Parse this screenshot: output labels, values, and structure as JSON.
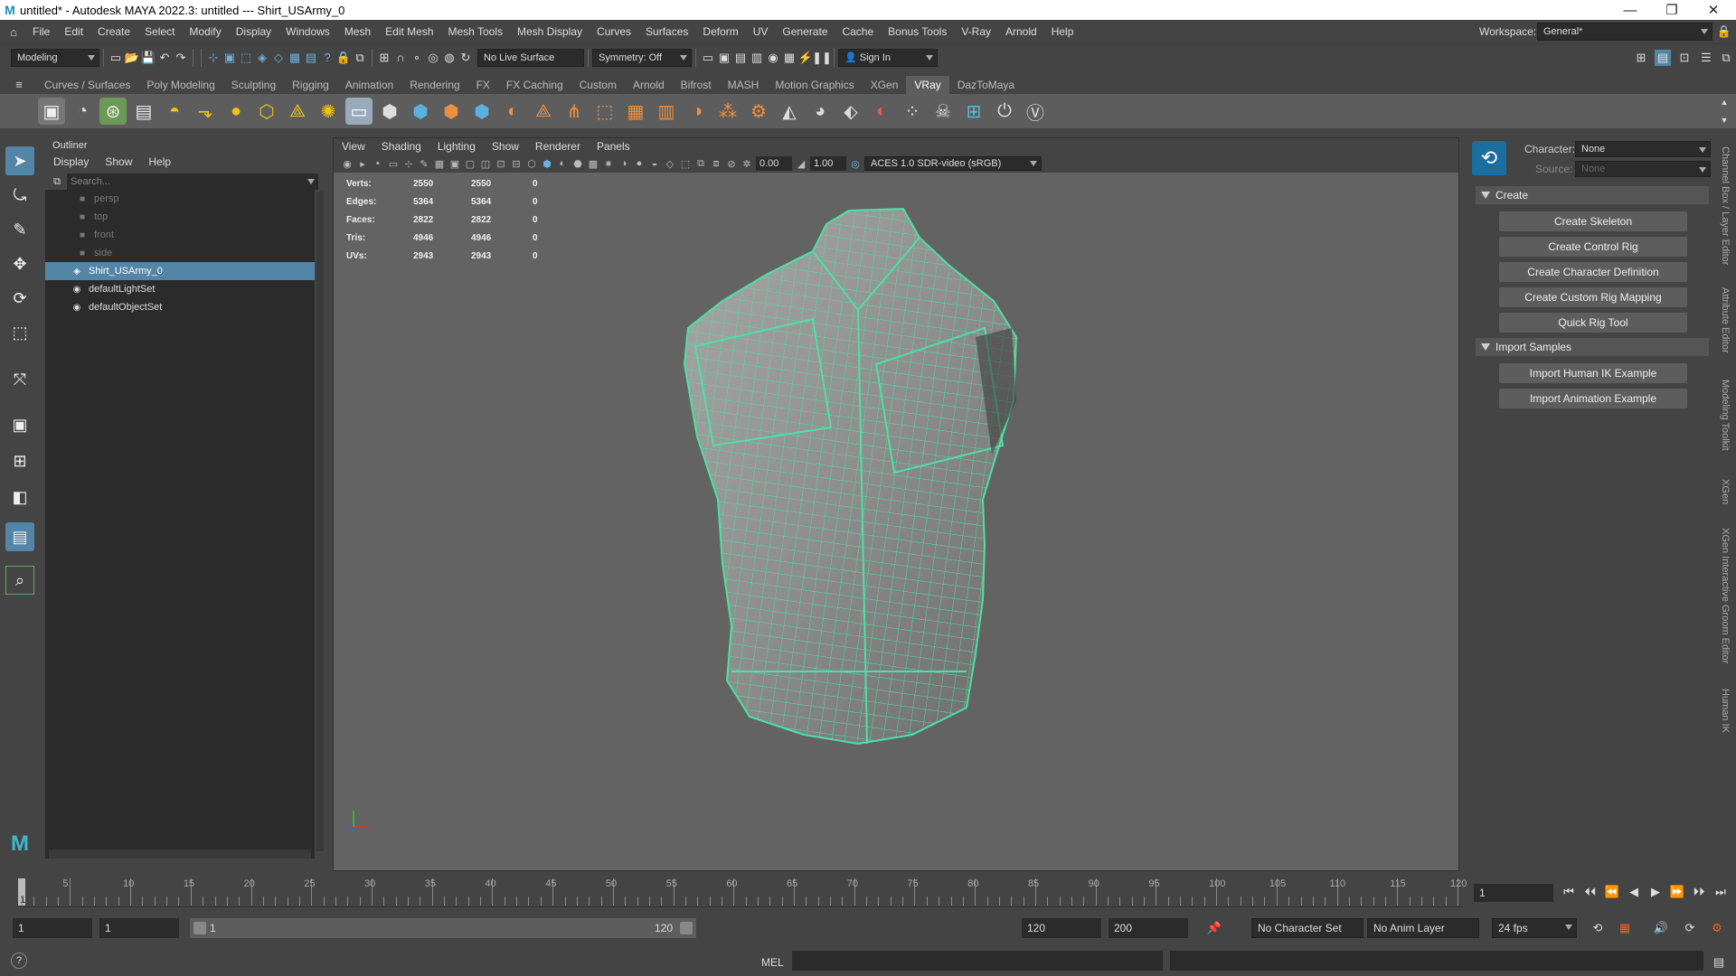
{
  "window": {
    "title": "untitled* - Autodesk MAYA 2022.3: untitled   ---   Shirt_USArmy_0",
    "logo": "M"
  },
  "menu": [
    "File",
    "Edit",
    "Create",
    "Select",
    "Modify",
    "Display",
    "Windows",
    "Mesh",
    "Edit Mesh",
    "Mesh Tools",
    "Mesh Display",
    "Curves",
    "Surfaces",
    "Deform",
    "UV",
    "Generate",
    "Cache",
    "Bonus Tools",
    "V-Ray",
    "Arnold",
    "Help"
  ],
  "workspace": {
    "label": "Workspace:",
    "value": "General*"
  },
  "status": {
    "mode": "Modeling",
    "live_surface": "No Live Surface",
    "symmetry": "Symmetry: Off",
    "sign_in": "Sign In"
  },
  "shelf_tabs": [
    "Curves / Surfaces",
    "Poly Modeling",
    "Sculpting",
    "Rigging",
    "Animation",
    "Rendering",
    "FX",
    "FX Caching",
    "Custom",
    "Arnold",
    "Bifrost",
    "MASH",
    "Motion Graphics",
    "XGen",
    "VRay",
    "DazToMaya"
  ],
  "active_shelf_tab": "VRay",
  "outliner": {
    "title": "Outliner",
    "menu": [
      "Display",
      "Show",
      "Help"
    ],
    "search_placeholder": "Search...",
    "items": [
      {
        "label": "persp",
        "icon": "camera-icon"
      },
      {
        "label": "top",
        "icon": "camera-icon"
      },
      {
        "label": "front",
        "icon": "camera-icon"
      },
      {
        "label": "side",
        "icon": "camera-icon"
      },
      {
        "label": "Shirt_USArmy_0",
        "icon": "mesh-icon"
      },
      {
        "label": "defaultLightSet",
        "icon": "set-icon"
      },
      {
        "label": "defaultObjectSet",
        "icon": "set-icon"
      }
    ],
    "selected": "Shirt_USArmy_0"
  },
  "viewport": {
    "menu": [
      "View",
      "Shading",
      "Lighting",
      "Show",
      "Renderer",
      "Panels"
    ],
    "exposure": "0.00",
    "gamma": "1.00",
    "color_space": "ACES 1.0 SDR-video (sRGB)",
    "hud": [
      {
        "label": "Verts:",
        "a": "2550",
        "b": "2550",
        "c": "0"
      },
      {
        "label": "Edges:",
        "a": "5364",
        "b": "5364",
        "c": "0"
      },
      {
        "label": "Faces:",
        "a": "2822",
        "b": "2822",
        "c": "0"
      },
      {
        "label": "Tris:",
        "a": "4946",
        "b": "4946",
        "c": "0"
      },
      {
        "label": "UVs:",
        "a": "2943",
        "b": "2943",
        "c": "0"
      }
    ]
  },
  "hik": {
    "character_label": "Character:",
    "character_value": "None",
    "source_label": "Source:",
    "source_value": "None",
    "create_section": "Create",
    "create_buttons": [
      "Create Skeleton",
      "Create Control Rig",
      "Create Character Definition",
      "Create Custom Rig Mapping",
      "Quick Rig Tool"
    ],
    "import_section": "Import Samples",
    "import_buttons": [
      "Import Human IK Example",
      "Import Animation Example"
    ]
  },
  "side_tabs": [
    "Channel Box / Layer Editor",
    "Attribute Editor",
    "Modeling Toolkit",
    "XGen",
    "XGen Interactive Groom Editor",
    "Human IK"
  ],
  "timeline": {
    "ticks": [
      "5",
      "10",
      "15",
      "20",
      "25",
      "30",
      "35",
      "40",
      "45",
      "50",
      "55",
      "60",
      "65",
      "70",
      "75",
      "80",
      "85",
      "90",
      "95",
      "100",
      "105",
      "110",
      "115",
      "120"
    ],
    "current": "1",
    "current_field": "1"
  },
  "range": {
    "start": "1",
    "playback_start": "1",
    "slider_start": "1",
    "slider_end": "120",
    "playback_end": "120",
    "end": "200",
    "char_set": "No Character Set",
    "anim_layer": "No Anim Layer",
    "fps": "24 fps"
  },
  "cmd": {
    "lang": "MEL"
  }
}
